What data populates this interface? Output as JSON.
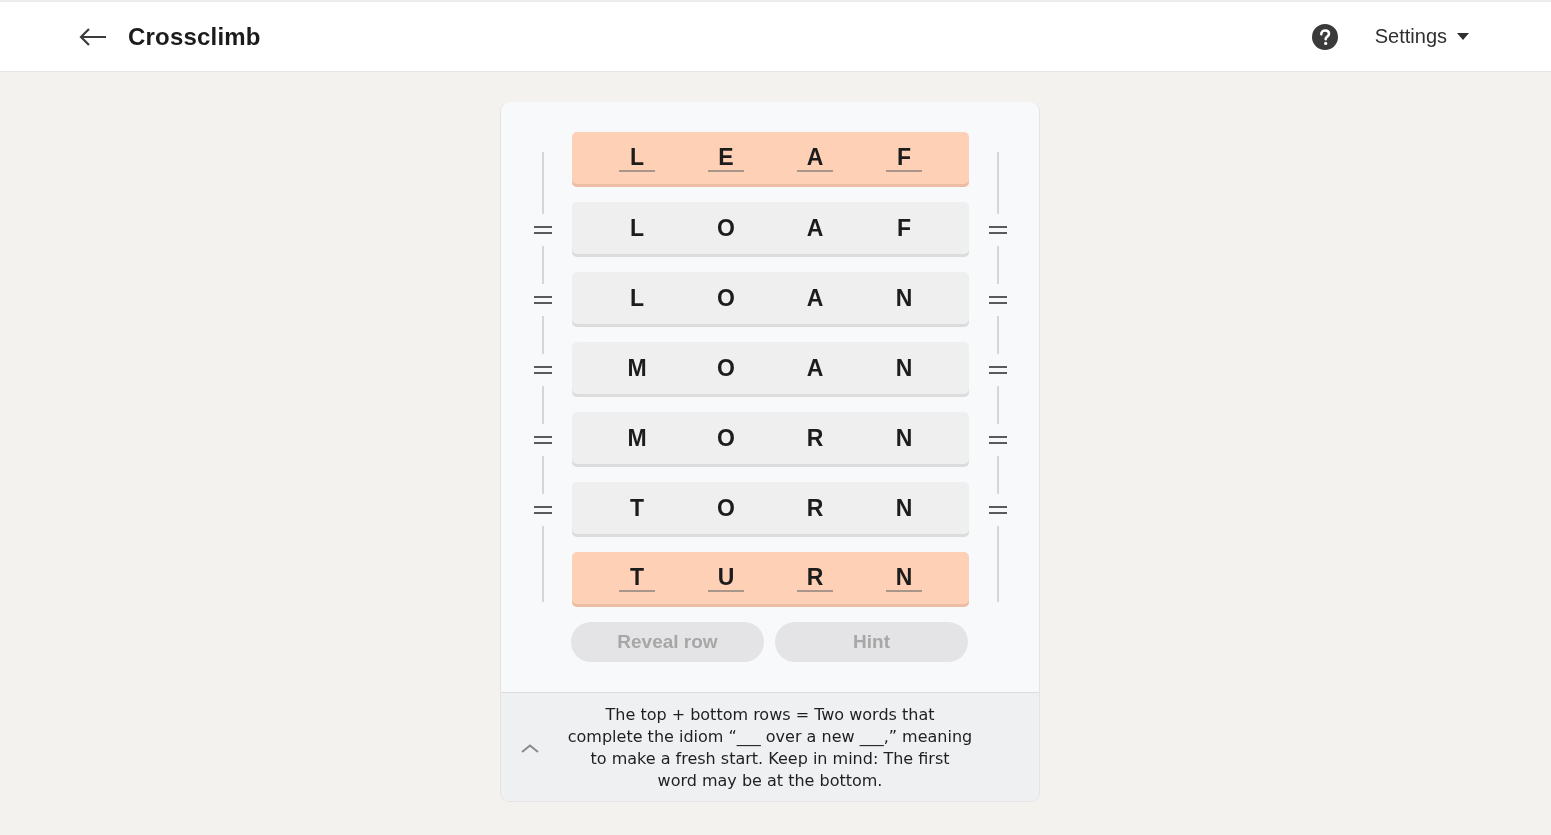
{
  "header": {
    "title": "Crossclimb",
    "settings_label": "Settings"
  },
  "rows": [
    {
      "kind": "end",
      "letters": [
        "L",
        "E",
        "A",
        "F"
      ]
    },
    {
      "kind": "middle",
      "letters": [
        "L",
        "O",
        "A",
        "F"
      ]
    },
    {
      "kind": "middle",
      "letters": [
        "L",
        "O",
        "A",
        "N"
      ]
    },
    {
      "kind": "middle",
      "letters": [
        "M",
        "O",
        "A",
        "N"
      ]
    },
    {
      "kind": "middle",
      "letters": [
        "M",
        "O",
        "R",
        "N"
      ]
    },
    {
      "kind": "middle",
      "letters": [
        "T",
        "O",
        "R",
        "N"
      ]
    },
    {
      "kind": "end",
      "letters": [
        "T",
        "U",
        "R",
        "N"
      ]
    }
  ],
  "buttons": [
    {
      "label": "Reveal row",
      "disabled": true
    },
    {
      "label": "Hint",
      "disabled": true
    }
  ],
  "clue": {
    "lines": [
      "The top + bottom rows = Two words that",
      "complete the idiom “___ over a new ___,” meaning",
      "to make a fresh start. Keep in mind: The first",
      "word may be at the bottom."
    ]
  }
}
